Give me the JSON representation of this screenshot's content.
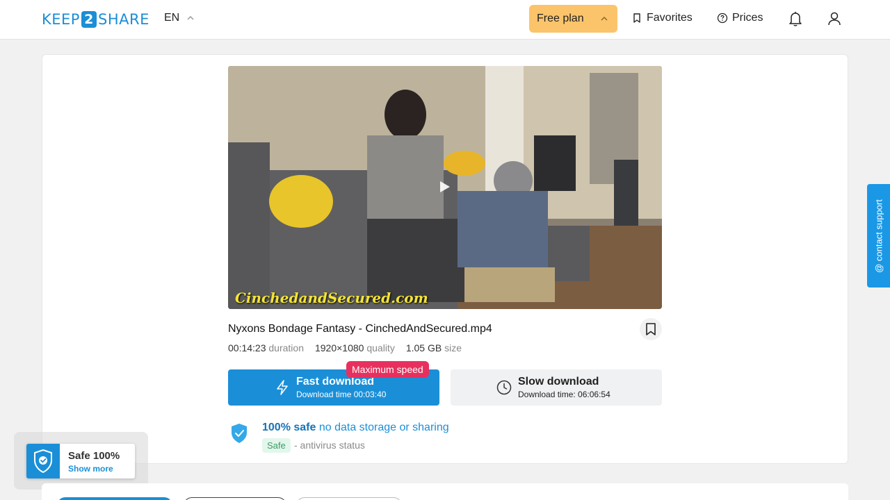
{
  "header": {
    "logo_pre": "KEEP",
    "logo_num": "2",
    "logo_post": "SHARE",
    "language": "EN",
    "plan_label": "Free plan",
    "favorites_label": "Favorites",
    "prices_label": "Prices"
  },
  "video": {
    "watermark": "CinchedandSecured.com"
  },
  "file": {
    "name": "Nyxons Bondage Fantasy - CinchedAndSecured.mp4",
    "duration_value": "00:14:23",
    "duration_label": "duration",
    "quality_value": "1920×1080",
    "quality_label": "quality",
    "size_value": "1.05 GB",
    "size_label": "size"
  },
  "download": {
    "badge": "Maximum speed",
    "fast_title": "Fast download",
    "fast_time": "Download time 00:03:40",
    "slow_title": "Slow download",
    "slow_time": "Download time: 06:06:54"
  },
  "safety": {
    "headline_bold": "100% safe",
    "headline_rest": " no data storage or sharing",
    "tag": "Safe",
    "status": "- antivirus status"
  },
  "safe_widget": {
    "title": "Safe 100%",
    "link": "Show more"
  },
  "support": {
    "label": "@ contact support"
  },
  "colors": {
    "brand_blue": "#1a8fd8",
    "plan_yellow": "#fbc46b",
    "badge_red": "#e8305e",
    "safe_green": "#3c9c64"
  }
}
